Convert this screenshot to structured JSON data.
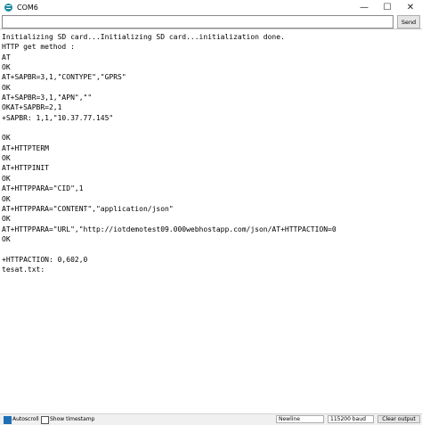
{
  "window": {
    "title": "COM6",
    "controls": {
      "minimize": "—",
      "maximize": "☐",
      "close": "✕"
    }
  },
  "send_bar": {
    "input_value": "",
    "send_label": "Send"
  },
  "console_lines": [
    "Initializing SD card...Initializing SD card...initialization done.",
    "HTTP get method :",
    "AT",
    "OK",
    "AT+SAPBR=3,1,\"CONTYPE\",\"GPRS\"",
    "OK",
    "AT+SAPBR=3,1,\"APN\",\"\"",
    "OKAT+SAPBR=2,1",
    "+SAPBR: 1,1,\"10.37.77.145\"",
    "",
    "OK",
    "AT+HTTPTERM",
    "OK",
    "AT+HTTPINIT",
    "OK",
    "AT+HTTPPARA=\"CID\",1",
    "OK",
    "AT+HTTPPARA=\"CONTENT\",\"application/json\"",
    "OK",
    "AT+HTTPPARA=\"URL\",\"http://iotdemotest09.000webhostapp.com/json/AT+HTTPACTION=0",
    "OK",
    "",
    "+HTTPACTION: 0,602,0",
    "tesat.txt:"
  ],
  "status_bar": {
    "autoscroll_label": "Autoscroll",
    "autoscroll_checked": true,
    "timestamp_label": "Show timestamp",
    "timestamp_checked": false,
    "line_ending": "Newline",
    "baud_rate": "115200 baud",
    "clear_label": "Clear output"
  },
  "colors": {
    "accent": "#1e6fb5",
    "app_icon": "#1f8aa0"
  }
}
